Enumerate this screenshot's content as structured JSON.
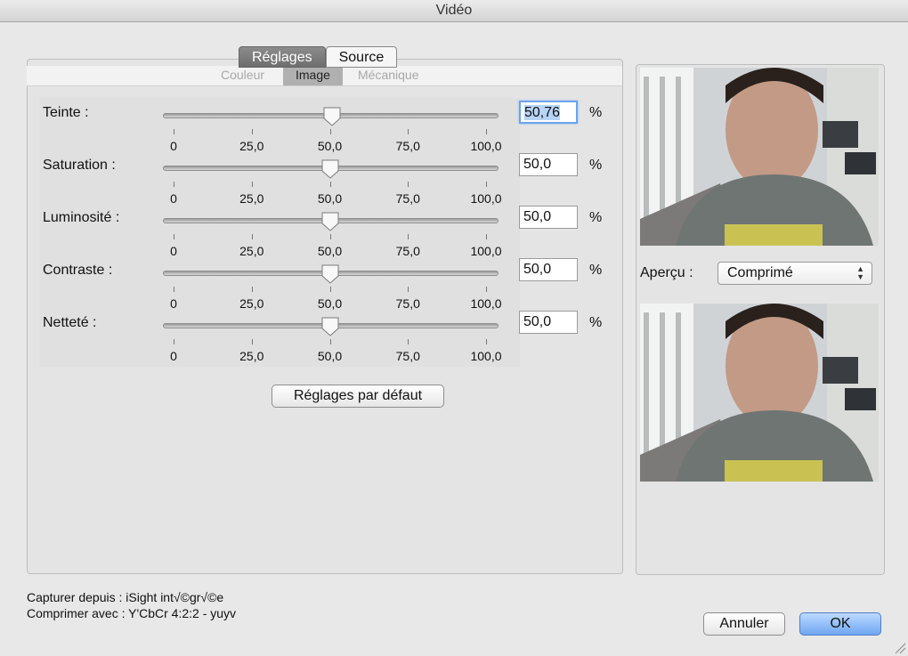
{
  "window": {
    "title": "Vidéo"
  },
  "tabs": [
    {
      "label": "Réglages",
      "active": true
    },
    {
      "label": "Source",
      "active": false
    }
  ],
  "subtabs": [
    {
      "label": "Couleur",
      "active": false
    },
    {
      "label": "Image",
      "active": true
    },
    {
      "label": "Mécanique",
      "active": false
    }
  ],
  "slider_scale": {
    "min": 0,
    "max": 100,
    "ticks": [
      "0",
      "25,0",
      "50,0",
      "75,0",
      "100,0"
    ]
  },
  "sliders": [
    {
      "label": "Teinte :",
      "value_text": "50,76",
      "value": 50.76,
      "unit": "%",
      "focused": true
    },
    {
      "label": "Saturation :",
      "value_text": "50,0",
      "value": 50.0,
      "unit": "%",
      "focused": false
    },
    {
      "label": "Luminosité :",
      "value_text": "50,0",
      "value": 50.0,
      "unit": "%",
      "focused": false
    },
    {
      "label": "Contraste :",
      "value_text": "50,0",
      "value": 50.0,
      "unit": "%",
      "focused": false
    },
    {
      "label": "Netteté :",
      "value_text": "50,0",
      "value": 50.0,
      "unit": "%",
      "focused": false
    }
  ],
  "defaults_button": "Réglages par défaut",
  "preview": {
    "label": "Aperçu :",
    "selected": "Comprimé"
  },
  "footer": {
    "capture": "Capturer depuis : iSight int√©gr√©e",
    "compress": "Comprimer avec : Y'CbCr 4:2:2 - yuyv"
  },
  "buttons": {
    "cancel": "Annuler",
    "ok": "OK"
  },
  "colors": {
    "accent": "#6fa7f2",
    "focus_ring": "#6ea4e8"
  }
}
